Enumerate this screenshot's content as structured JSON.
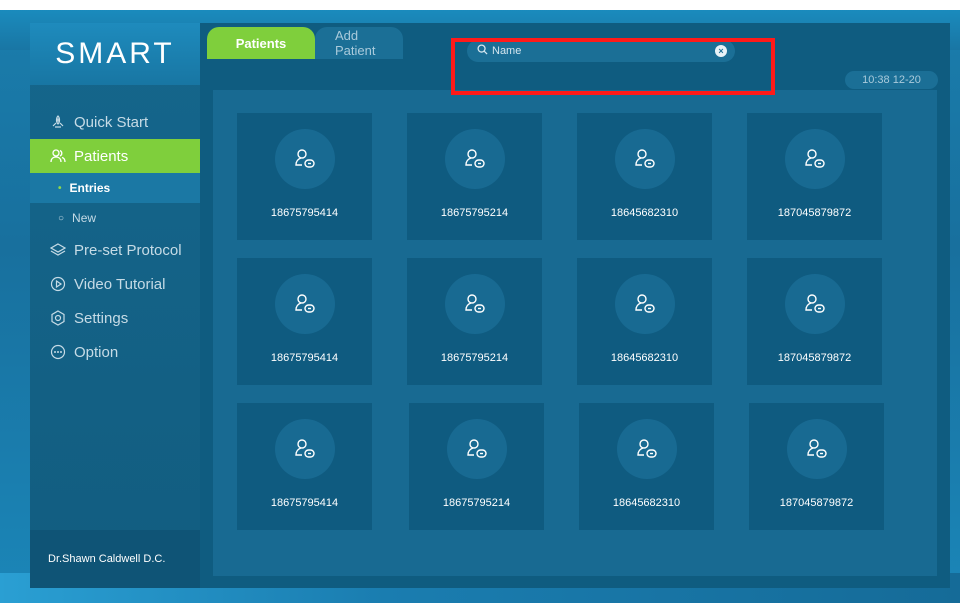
{
  "app": {
    "logo": "SMART"
  },
  "sidebar": {
    "items": [
      {
        "label": "Quick Start",
        "icon": "rocket-icon"
      },
      {
        "label": "Patients",
        "icon": "users-icon",
        "active": true
      },
      {
        "label": "Pre-set Protocol",
        "icon": "layers-icon"
      },
      {
        "label": "Video Tutorial",
        "icon": "play-circle-icon"
      },
      {
        "label": "Settings",
        "icon": "gear-icon"
      },
      {
        "label": "Option",
        "icon": "more-circle-icon"
      }
    ],
    "sub_items": [
      {
        "label": "Entries",
        "active": true
      },
      {
        "label": "New"
      }
    ],
    "doctor": "Dr.Shawn Caldwell D.C."
  },
  "tabs": [
    {
      "label": "Patients",
      "active": true
    },
    {
      "label": "Add Patient"
    }
  ],
  "search": {
    "placeholder": "Name"
  },
  "datetime": "10:38  12-20",
  "patients": [
    "18675795414",
    "18675795214",
    "18645682310",
    "187045879872",
    "18675795414",
    "18675795214",
    "18645682310",
    "187045879872",
    "18675795414",
    "18675795214",
    "18645682310",
    "187045879872"
  ],
  "colors": {
    "accent": "#7fcf3c",
    "panel": "#0f5c80",
    "highlight": "#ff1a1a"
  }
}
